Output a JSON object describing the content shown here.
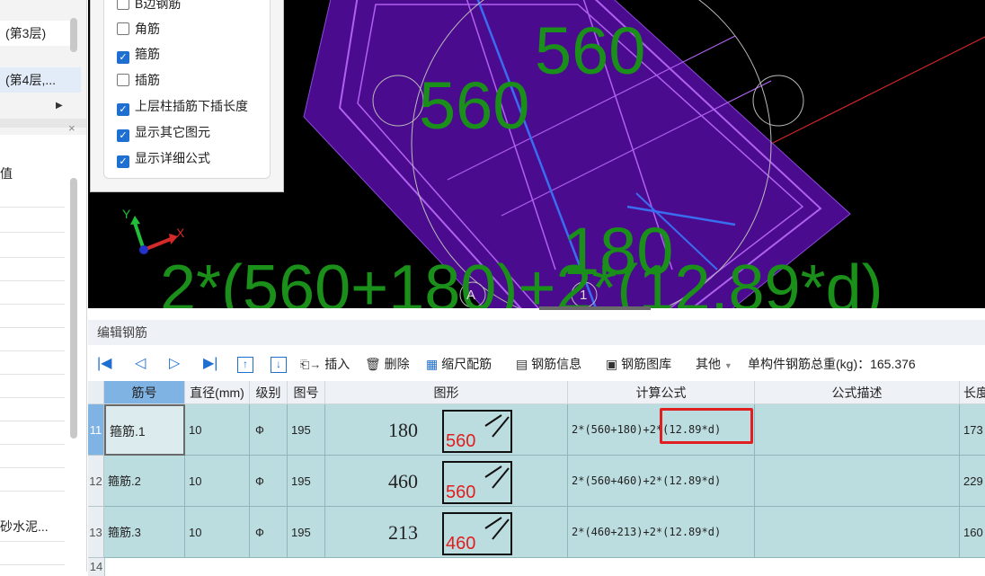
{
  "floor_list": {
    "items": [
      {
        "label": "(第3层)",
        "selected": false
      },
      {
        "label": "(第4层,...",
        "selected": true
      }
    ],
    "expand_arrow": "triangle-right-icon",
    "close_icon": "close-icon"
  },
  "properties": {
    "col_header": "值",
    "last_value": "砂水泥..."
  },
  "options": [
    {
      "label": "B边钢筋",
      "checked": false
    },
    {
      "label": "角筋",
      "checked": false
    },
    {
      "label": "箍筋",
      "checked": true
    },
    {
      "label": "插筋",
      "checked": false
    },
    {
      "label": "上层柱插筋下插长度",
      "checked": true
    },
    {
      "label": "显示其它图元",
      "checked": true
    },
    {
      "label": "显示详细公式",
      "checked": true
    }
  ],
  "canvas": {
    "labels": {
      "dim_560_top": "560",
      "dim_560_left": "560",
      "dim_180": "180",
      "formula": "2*(560+180)+2*(12.89*d)",
      "axis_a": "A",
      "axis_1": "1",
      "axis_x": "X",
      "axis_y": "Y"
    },
    "colors": {
      "background": "#000000",
      "column_fill": "#4b0b8f",
      "rebar": "#b061f0",
      "dimension_text": "#1a8f1a",
      "axis_line": "#d42a2a"
    }
  },
  "edit_panel": {
    "title": "编辑钢筋",
    "toolbar": {
      "nav_icons": [
        "first-icon",
        "prev-icon",
        "next-icon",
        "last-icon",
        "move-up-icon",
        "move-down-icon"
      ],
      "insert": "插入",
      "delete": "删除",
      "scale_rebar": "缩尺配筋",
      "rebar_info": "钢筋信息",
      "rebar_library": "钢筋图库",
      "other": "其他",
      "total_weight_label": "单构件钢筋总重(kg)：165.376"
    },
    "columns": [
      "筋号",
      "直径(mm)",
      "级别",
      "图号",
      "图形",
      "计算公式",
      "公式描述",
      "长度"
    ],
    "rows": [
      {
        "num": "11",
        "name": "箍筋.1",
        "diameter": "10",
        "grade": "Ф",
        "figure_no": "195",
        "shape_left": "180",
        "shape_bottom": "560",
        "formula": "2*(560+180)+2*(12.89*d)",
        "desc": "",
        "length": "173"
      },
      {
        "num": "12",
        "name": "箍筋.2",
        "diameter": "10",
        "grade": "Ф",
        "figure_no": "195",
        "shape_left": "460",
        "shape_bottom": "560",
        "formula": "2*(560+460)+2*(12.89*d)",
        "desc": "",
        "length": "229"
      },
      {
        "num": "13",
        "name": "箍筋.3",
        "diameter": "10",
        "grade": "Ф",
        "figure_no": "195",
        "shape_left": "213",
        "shape_bottom": "460",
        "formula": "2*(460+213)+2*(12.89*d)",
        "desc": "",
        "length": "160"
      }
    ],
    "next_row_num": "14",
    "highlight_color": "#e02020"
  }
}
